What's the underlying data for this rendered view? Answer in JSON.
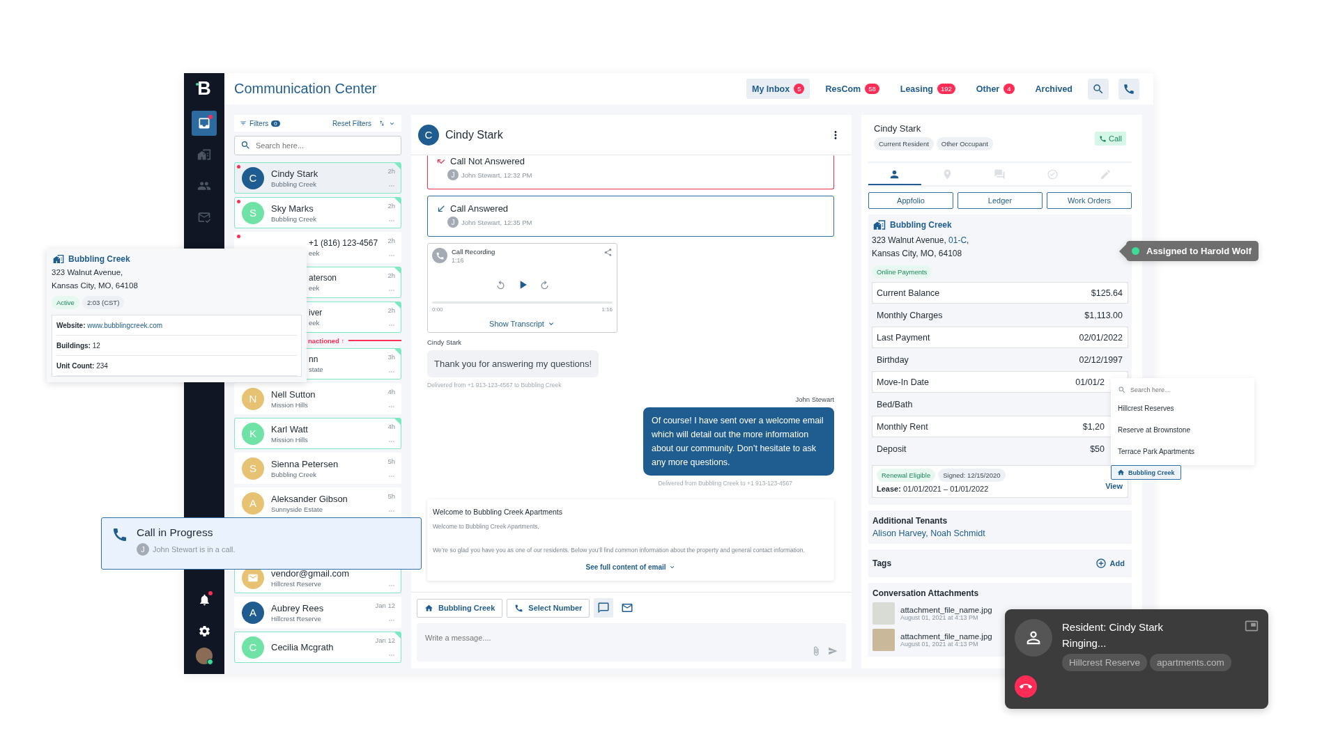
{
  "sidebar": {
    "logo": "B",
    "nav": [
      {
        "selected": true,
        "alert": true
      },
      {
        "selected": false,
        "alert": false
      },
      {
        "selected": false,
        "alert": false
      },
      {
        "selected": false,
        "alert": false
      }
    ],
    "bottom": [
      {
        "alert": true
      },
      {
        "alert": false
      }
    ],
    "user": {
      "online": true
    }
  },
  "header": {
    "title": "Communication Center",
    "tabs": [
      {
        "label": "My Inbox",
        "count": "5",
        "selected": true
      },
      {
        "label": "ResCom",
        "count": "58",
        "selected": false
      },
      {
        "label": "Leasing",
        "count": "192",
        "selected": false
      },
      {
        "label": "Other",
        "count": "4",
        "selected": false
      },
      {
        "label": "Archived",
        "selected": false
      }
    ]
  },
  "conversation_list": {
    "filters": "Filters",
    "filters_count": "0",
    "reset": "Reset Filters",
    "search_placeholder": "Search here...",
    "items": [
      {
        "kind": "contact",
        "name": "Cindy Stark",
        "subtitle": "Bubbling Creek",
        "time": "2h",
        "initial": "C",
        "color": "#1f5c8f",
        "unread": true,
        "highlighted": true,
        "selected": true,
        "covered": false
      },
      {
        "kind": "contact",
        "name": "Sky Marks",
        "subtitle": "Bubbling Creek",
        "time": "2h",
        "initial": "S",
        "color": "#6fe3a5",
        "unread": true,
        "highlighted": true,
        "selected": false,
        "covered": false
      },
      {
        "kind": "contact",
        "name": "+1 (816) 123-4567",
        "subtitle": "eek",
        "time": "2h",
        "unread": true,
        "highlighted": false,
        "selected": false,
        "covered": true
      },
      {
        "kind": "contact",
        "name": "aterson",
        "subtitle": "eek",
        "time": "2h",
        "unread": false,
        "highlighted": true,
        "selected": false,
        "covered": true
      },
      {
        "kind": "contact",
        "name": "iver",
        "subtitle": "eek",
        "time": "2h",
        "unread": false,
        "highlighted": true,
        "selected": false,
        "covered": true
      },
      {
        "kind": "divider",
        "label": "nactioned",
        "arrow": "↑"
      },
      {
        "kind": "contact",
        "name": "nn",
        "subtitle": "state",
        "time": "3h",
        "unread": false,
        "highlighted": true,
        "selected": false,
        "covered": true
      },
      {
        "kind": "contact",
        "name": "Nell Sutton",
        "subtitle": "Mission Hills",
        "time": "4h",
        "initial": "N",
        "color": "#e6c272",
        "unread": false,
        "highlighted": false,
        "selected": false,
        "covered": false
      },
      {
        "kind": "contact",
        "name": "Karl Watt",
        "subtitle": "Mission Hills",
        "time": "4h",
        "initial": "K",
        "color": "#6fe3a5",
        "unread": false,
        "highlighted": true,
        "selected": false,
        "covered": false
      },
      {
        "kind": "contact",
        "name": "Sienna Petersen",
        "subtitle": "Bubbling Creek",
        "time": "5h",
        "initial": "S",
        "color": "#e6c272",
        "unread": false,
        "highlighted": false,
        "selected": false,
        "covered": false
      },
      {
        "kind": "contact",
        "name": "Aleksander Gibson",
        "subtitle": "Sunnyside Estate",
        "time": "5h",
        "initial": "A",
        "color": "#e6c272",
        "unread": false,
        "highlighted": false,
        "selected": false,
        "covered": false
      },
      {
        "kind": "call_banner",
        "title": "Call in Progress",
        "initial": "J",
        "text": "John Stewart is in a call."
      },
      {
        "kind": "email",
        "name": "vendor@gmail.com",
        "subtitle": "Hillcrest Reserve",
        "color": "#e6c272",
        "unread": false,
        "highlighted": true,
        "selected": false,
        "covered": false
      },
      {
        "kind": "contact",
        "name": "Aubrey Rees",
        "subtitle": "Hillcrest Reserve",
        "time": "Jan 12",
        "initial": "A",
        "color": "#1f5c8f",
        "unread": false,
        "highlighted": false,
        "selected": false,
        "covered": false
      },
      {
        "kind": "contact",
        "name": "Cecilia Mcgrath",
        "time": "Jan 12",
        "initial": "C",
        "color": "#6fe3a5",
        "unread": false,
        "highlighted": true,
        "selected": false,
        "covered": false
      }
    ]
  },
  "chat": {
    "contact": {
      "initial": "C",
      "name": "Cindy Stark"
    },
    "messages": [
      {
        "kind": "call_missed",
        "title": "Call Not Answered",
        "initial": "J",
        "meta": "John Stewart, 12:32 PM"
      },
      {
        "kind": "call_answered",
        "title": "Call Answered",
        "initial": "J",
        "meta": "John Stewart, 12:35 PM"
      },
      {
        "kind": "recording",
        "title": "Call Recording",
        "duration": "1:16",
        "level": 0,
        "start": "0:00",
        "end": "1:16",
        "transcript": "Show Transcript"
      },
      {
        "kind": "incoming",
        "sender": "Cindy Stark",
        "text": "Thank you for answering my questions!",
        "meta": "Delivered from +1 913-123-4567 to Bubbling Creek"
      },
      {
        "kind": "outgoing",
        "sender": "John Stewart",
        "text": "Of course! I have sent over a welcome email which will detail out the more information about our community. Don’t hesitate to ask any more questions.",
        "meta": "Delivered from Bubbling Creek to +1 913-123-4567"
      },
      {
        "kind": "email",
        "subject": "Welcome to Bubbling Creek Apartments",
        "greeting": "Welcome to Bubbling Creek Apartments,",
        "body": "We’re so glad you have you as one of our residents. Below you’ll find common information about the property and general contact information.",
        "more": "See full content of email"
      }
    ],
    "composer": {
      "property": "Bubbling Creek",
      "number": "Select Number",
      "modes": [
        {
          "selected": true
        },
        {
          "selected": false
        }
      ],
      "placeholder": "Write a message...."
    }
  },
  "resident": {
    "name": "Cindy Stark",
    "tags": [
      "Current Resident",
      "Other Occupant"
    ],
    "call": "Call",
    "tabs": [
      {
        "selected": true
      },
      {
        "selected": false
      },
      {
        "selected": false
      },
      {
        "selected": false
      },
      {
        "selected": false
      }
    ],
    "links": [
      "Appfolio",
      "Ledger",
      "Work Orders"
    ],
    "property": {
      "name": "Bubbling Creek",
      "street": "323 Walnut Avenue, ",
      "unit": "01-C",
      "street_end": ",",
      "city": "Kansas City, MO, 64108",
      "badge": "Online Payments"
    },
    "details": [
      {
        "label": "Current Balance",
        "value": "$125.64"
      },
      {
        "label": "Monthly Charges",
        "value": "$1,113.00"
      },
      {
        "label": "Last Payment",
        "value": "02/01/2022"
      },
      {
        "label": "Birthday",
        "value": "02/12/1997"
      },
      {
        "label": "Move-In Date",
        "value": "01/01/2",
        "covered": true
      },
      {
        "label": "Bed/Bath"
      },
      {
        "label": "Monthly Rent",
        "value": "$1,20",
        "covered": true
      },
      {
        "label": "Deposit",
        "value": "$50",
        "covered": true
      }
    ],
    "lease": {
      "renewal": "Renewal Eligible",
      "signed": "Signed: 12/15/2020",
      "period": "**Lease:** 01/01/2021 – 01/01/2022",
      "view": "View"
    },
    "tenants": {
      "title": "Additional Tenants",
      "names": "Alison Harvey, Noah Schmidt"
    },
    "tags_section": {
      "title": "Tags",
      "add": "Add"
    },
    "attachments": {
      "title": "Conversation Attachments",
      "items": [
        {
          "name": "attachment_file_name.jpg",
          "date": "August 01, 2021 at 4:13 PM"
        },
        {
          "name": "attachment_file_name.jpg",
          "date": "August 01, 2021 at 4:13 PM"
        }
      ]
    }
  },
  "property_popover": {
    "name": "Bubbling Creek",
    "address": [
      "323 Walnut Avenue,",
      "Kansas City, MO, 64108"
    ],
    "status": "Active",
    "time": "2:03 (CST)",
    "facts": [
      {
        "kind": "link",
        "label": "Website:",
        "value": "www.bubblingcreek.com"
      },
      {
        "kind": "text",
        "label": "Buildings:",
        "value": "12"
      },
      {
        "kind": "text",
        "label": "Unit Count:",
        "value": "234"
      }
    ]
  },
  "assignment_tooltip": {
    "text": "Assigned to Harold Wolf",
    "online": true
  },
  "property_dropdown": {
    "placeholder": "Search here...",
    "options": [
      "Hillcrest Reserves",
      "Reserve at Brownstone",
      "Terrace Park Apartments"
    ],
    "chip": "Bubbling Creek"
  },
  "incoming_call": {
    "title": "Resident: Cindy Stark",
    "status": "Ringing...",
    "chips": [
      "Hillcrest Reserve",
      "apartments.com"
    ]
  }
}
